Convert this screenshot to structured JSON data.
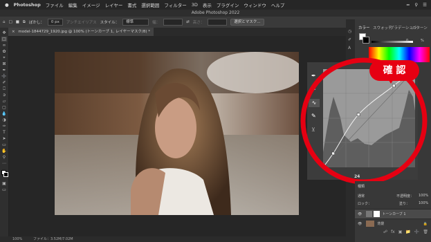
{
  "menubar": {
    "apple": "",
    "app": "Photoshop",
    "items": [
      "ファイル",
      "編集",
      "イメージ",
      "レイヤー",
      "書式",
      "選択範囲",
      "フィルター",
      "3D",
      "表示",
      "プラグイン",
      "ウィンドウ",
      "ヘルプ"
    ]
  },
  "window": {
    "title": "Adobe Photoshop 2022"
  },
  "options": {
    "feather_label": "ぼかし：",
    "feather_value": "0 px",
    "antialias_label": "アンチエイリアス",
    "style_label": "スタイル：",
    "style_value": "標準",
    "width_label": "幅：",
    "height_label": "高さ：",
    "mask_button": "選択とマスク..."
  },
  "document": {
    "tab_label": "model-1844729_1920.jpg @ 100% (トーンカーブ 1, レイヤーマスク/8) *",
    "close_glyph": "×"
  },
  "status": {
    "zoom": "100%",
    "file_info": "ファイル：3.52M/7.02M"
  },
  "panels": {
    "tabs": [
      "カラー",
      "スウォッチ",
      "グラデーション",
      "パターン"
    ],
    "slider_value": "0",
    "slider_unit": "%",
    "props_value": "24",
    "layers_kind": "種類",
    "blend_mode": "通常",
    "opacity_label": "不透明度：",
    "opacity_value": "100%",
    "lock_label": "ロック：",
    "fill_label": "塗り：",
    "fill_value": "100%",
    "layers": [
      {
        "name": "トーンカーブ 1"
      },
      {
        "name": "背景"
      }
    ]
  },
  "annotation": {
    "text": "確 認",
    "color": "#e60012"
  },
  "chart_data": {
    "type": "line",
    "title": "",
    "xlabel": "",
    "ylabel": "",
    "xlim": [
      0,
      255
    ],
    "ylim": [
      0,
      255
    ],
    "series": [
      {
        "x": [
          0,
          28,
          98,
          196,
          255
        ],
        "y": [
          0,
          36,
          137,
          212,
          255
        ]
      }
    ]
  }
}
